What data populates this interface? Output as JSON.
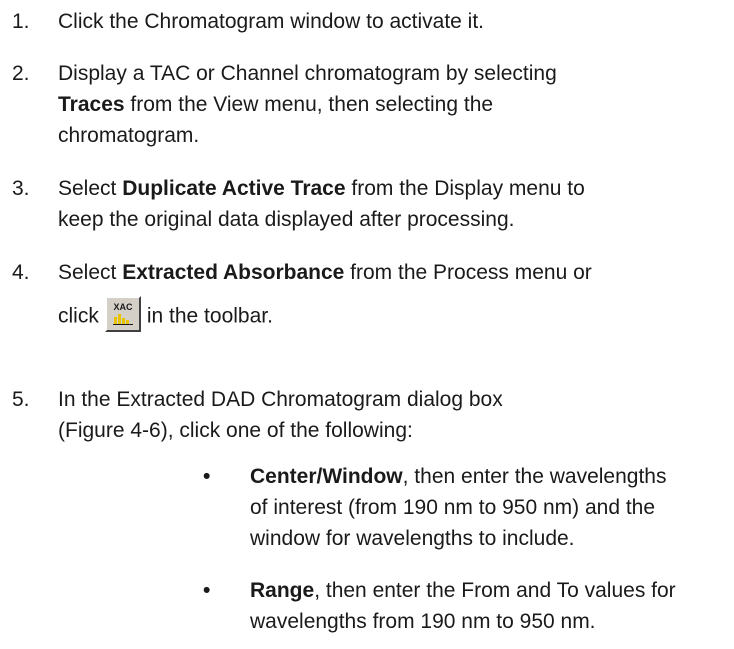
{
  "steps": [
    {
      "number": "1.",
      "line1": "Click the Chromatogram window to activate it."
    },
    {
      "number": "2.",
      "line1": "Display a TAC or Channel chromatogram by selecting",
      "bold1": "Traces",
      "line2_rest": " from the View menu, then selecting the",
      "line3": "chromatogram."
    },
    {
      "number": "3.",
      "line1_pre": "Select ",
      "bold1": "Duplicate Active Trace",
      "line1_post": " from the Display menu to",
      "line2": "keep the original data displayed after processing."
    },
    {
      "number": "4.",
      "line1_pre": "Select ",
      "bold1": "Extracted Absorbance",
      "line1_post": " from the Process menu or",
      "line2_pre": "click",
      "line2_post": "in the toolbar.",
      "icon_name": "xac-icon",
      "icon_text": "XAC"
    },
    {
      "number": "5.",
      "line1": "In the Extracted DAD Chromatogram dialog box",
      "line2": "(Figure 4-6), click one of the following:"
    }
  ],
  "bullets": [
    {
      "symbol": "•",
      "bold": "Center/Window",
      "line1_rest": ", then enter the wavelengths",
      "line2": "of interest (from 190 nm to 950 nm) and the",
      "line3": "window for wavelengths to include."
    },
    {
      "symbol": "•",
      "bold": "Range",
      "line1_rest": ", then enter the From and To values for",
      "line2": "wavelengths from 190 nm to 950 nm."
    }
  ],
  "colors": {
    "text": "#1a1a1a",
    "button_face": "#d4d0c8",
    "icon_bars": "#e8c400"
  }
}
